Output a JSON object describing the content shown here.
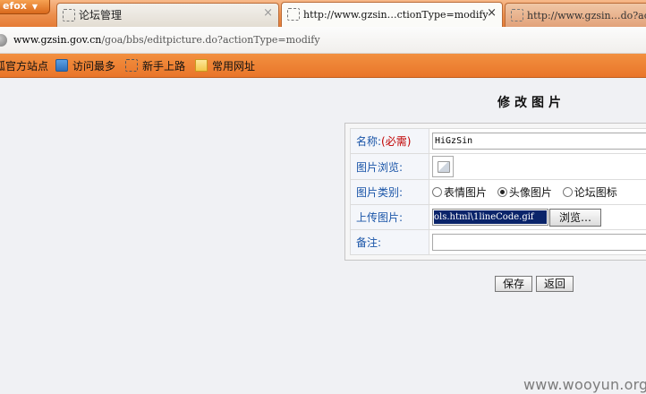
{
  "browser": {
    "app_button": "efox",
    "tabs": [
      {
        "title": "论坛管理",
        "close": "×"
      },
      {
        "title": "http://www.gzsin…ctionType=modify",
        "close": "×"
      },
      {
        "title": "http://www.gzsin…do?ac"
      }
    ],
    "url_host": "www.gzsin.gov.cn",
    "url_path": "/goa/bbs/editpicture.do?actionType=modify",
    "bookmarks": [
      "狐官方站点",
      "访问最多",
      "新手上路",
      "常用网址"
    ]
  },
  "page": {
    "title": "修改图片",
    "form": {
      "name_label": "名称:",
      "name_required": "(必需)",
      "name_value": "HiGzSin",
      "preview_label": "图片浏览:",
      "type_label": "图片类别:",
      "type_options": [
        "表情图片",
        "头像图片",
        "论坛图标"
      ],
      "type_selected": "头像图片",
      "upload_label": "上传图片:",
      "upload_value": "ols.html\\1lineCode.gif",
      "browse_label": "浏览…",
      "remark_label": "备注:",
      "remark_value": ""
    },
    "save_label": "保存",
    "back_label": "返回"
  },
  "watermark": "www.wooyun.org"
}
